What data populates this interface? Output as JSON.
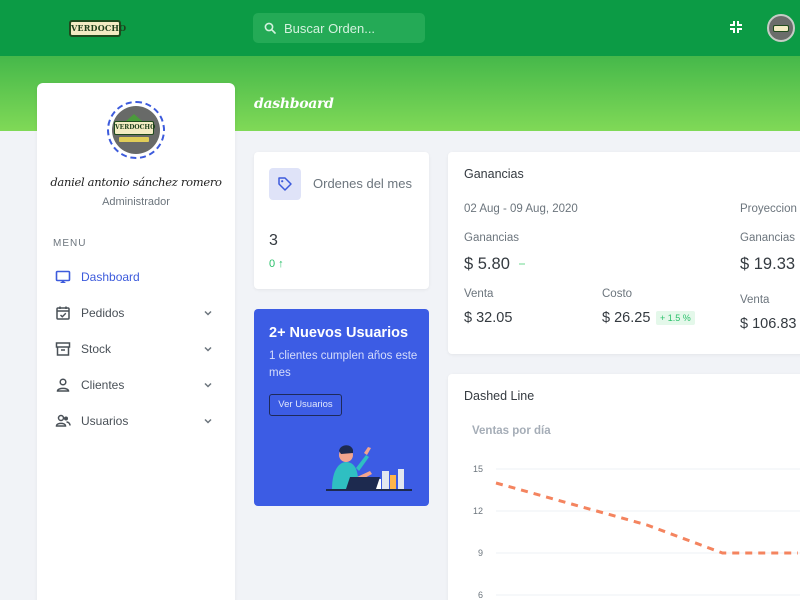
{
  "header": {
    "logo_text": "VERDOCHO",
    "search_placeholder": "Buscar Orden...",
    "fullscreen_icon": "fullscreen-exit-icon",
    "colors": {
      "bar": "#0c9b45",
      "accent": "#3d5bdc"
    }
  },
  "banner": {
    "title": "dashboard"
  },
  "sidebar": {
    "logo_text": "VERDOCHO",
    "user_name": "daniel antonio sánchez romero",
    "user_role": "Administrador",
    "menu_label": "MENU",
    "items": [
      {
        "label": "Dashboard",
        "icon": "monitor-icon",
        "active": true
      },
      {
        "label": "Pedidos",
        "icon": "calendar-check-icon",
        "active": false
      },
      {
        "label": "Stock",
        "icon": "archive-icon",
        "active": false
      },
      {
        "label": "Clientes",
        "icon": "person-icon",
        "active": false
      },
      {
        "label": "Usuarios",
        "icon": "people-icon",
        "active": false
      }
    ]
  },
  "orders_card": {
    "title": "Ordenes del mes",
    "count": "3",
    "delta": "0 ↑",
    "icon": "tag-icon"
  },
  "users_card": {
    "title": "2+ Nuevos Usuarios",
    "text": "1 clientes cumplen años este mes",
    "button": "Ver Usuarios"
  },
  "earnings_card": {
    "title": "Ganancias",
    "period": "02 Aug - 09 Aug, 2020",
    "projection_label": "Proyeccion",
    "left": {
      "ganancias_label": "Ganancias",
      "ganancias_value": "$ 5.80",
      "venta_label": "Venta",
      "venta_value": "$ 32.05",
      "costo_label": "Costo",
      "costo_value": "$ 26.25",
      "costo_badge": "+ 1.5 %"
    },
    "right": {
      "ganancias_label": "Ganancias",
      "ganancias_value": "$ 19.33",
      "venta_label": "Venta",
      "venta_value": "$ 106.83"
    }
  },
  "chart_card": {
    "title": "Dashed Line",
    "chart_data": {
      "type": "line",
      "title": "Ventas por día",
      "y_ticks": [
        "15",
        "12",
        "9",
        "6"
      ],
      "ylim": [
        6,
        15
      ],
      "series": [
        {
          "line_style": "dashed",
          "color": "#f4845f",
          "x": [
            0,
            1,
            2,
            3,
            4
          ],
          "values": [
            14,
            12.5,
            11,
            9,
            9
          ]
        }
      ],
      "grid": true
    }
  }
}
